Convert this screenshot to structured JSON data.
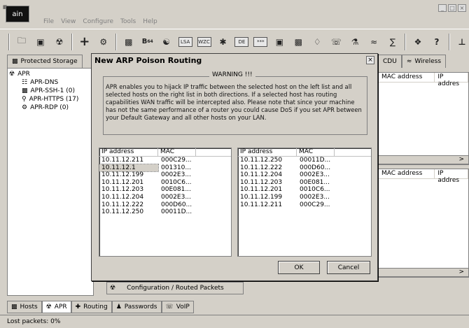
{
  "app": {
    "logo_text": "ain",
    "menus": [
      "File",
      "View",
      "Configure",
      "Tools",
      "Help"
    ]
  },
  "toolbar_icons": [
    "open-icon",
    "network-card-icon",
    "sniffer-icon",
    "add-icon",
    "scan-icon",
    "apr-icon",
    "base64-icon",
    "hash-icon",
    "lsa-icon",
    "wireless-icon",
    "certificate-icon",
    "tool-icon",
    "password-icon",
    "box-icon",
    "traceroute-icon",
    "camera-icon",
    "voip-icon",
    "cisco-icon",
    "wifi-icon",
    "info-icon",
    "help-icon",
    "antenna-icon"
  ],
  "main_tabs": [
    {
      "label": "Protected Storage",
      "icon": "storage-icon"
    }
  ],
  "right_tabs": [
    {
      "label": "CDU"
    },
    {
      "label": "Wireless"
    }
  ],
  "tree": {
    "root": "APR",
    "children": [
      "APR-DNS",
      "APR-SSH-1 (0)",
      "APR-HTTPS (17)",
      "APR-RDP (0)"
    ]
  },
  "right_panel": {
    "headers_top": [
      "MAC address",
      "IP addres"
    ],
    "headers_bottom": [
      "MAC address",
      "IP addres"
    ]
  },
  "dialog": {
    "title": "New ARP Poison Routing",
    "warning_title": "WARNING !!!",
    "warning_text": "APR enables you to hijack IP traffic between the selected host on the left list and all selected hosts on the right list in both directions. If a selected host has routing capabilities WAN traffic will be intercepted also. Please note that since your machine has not the same performance of a router you could cause DoS if you set APR between your Default Gateway and all other hosts on your LAN.",
    "left_list": {
      "headers": [
        "IP address",
        "MAC"
      ],
      "rows": [
        {
          "ip": "10.11.12.211",
          "mac": "000C29..."
        },
        {
          "ip": "10.11.12.1",
          "mac": "001310..."
        },
        {
          "ip": "10.11.12.199",
          "mac": "0002E3..."
        },
        {
          "ip": "10.11.12.201",
          "mac": "0010C6..."
        },
        {
          "ip": "10.11.12.203",
          "mac": "00E081..."
        },
        {
          "ip": "10.11.12.204",
          "mac": "0002E3..."
        },
        {
          "ip": "10.11.12.222",
          "mac": "000D60..."
        },
        {
          "ip": "10.11.12.250",
          "mac": "00011D..."
        }
      ]
    },
    "right_list": {
      "headers": [
        "IP address",
        "MAC"
      ],
      "rows": [
        {
          "ip": "10.11.12.250",
          "mac": "00011D..."
        },
        {
          "ip": "10.11.12.222",
          "mac": "000D60..."
        },
        {
          "ip": "10.11.12.204",
          "mac": "0002E3..."
        },
        {
          "ip": "10.11.12.203",
          "mac": "00E081..."
        },
        {
          "ip": "10.11.12.201",
          "mac": "0010C6..."
        },
        {
          "ip": "10.11.12.199",
          "mac": "0002E3..."
        },
        {
          "ip": "10.11.12.211",
          "mac": "000C29..."
        }
      ]
    },
    "ok_label": "OK",
    "cancel_label": "Cancel"
  },
  "subtab": {
    "label": "Configuration / Routed Packets"
  },
  "bottom_tabs": [
    {
      "label": "Hosts",
      "icon": "hosts-icon"
    },
    {
      "label": "APR",
      "icon": "apr-icon"
    },
    {
      "label": "Routing",
      "icon": "routing-icon"
    },
    {
      "label": "Passwords",
      "icon": "passwords-icon"
    },
    {
      "label": "VoIP",
      "icon": "voip-icon"
    }
  ],
  "status": {
    "text": "Lost packets:  0%"
  }
}
